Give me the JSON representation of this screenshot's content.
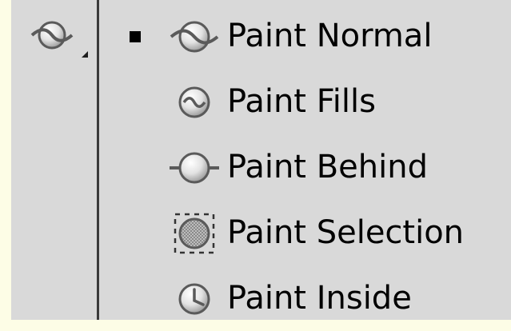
{
  "tool": {
    "icon": "paint-normal-icon",
    "has_flyout": true
  },
  "menu": {
    "items": [
      {
        "label": "Paint Normal",
        "icon": "paint-normal-icon",
        "selected": true
      },
      {
        "label": "Paint Fills",
        "icon": "paint-fills-icon",
        "selected": false
      },
      {
        "label": "Paint Behind",
        "icon": "paint-behind-icon",
        "selected": false
      },
      {
        "label": "Paint Selection",
        "icon": "paint-selection-icon",
        "selected": false
      },
      {
        "label": "Paint Inside",
        "icon": "paint-inside-icon",
        "selected": false
      }
    ]
  },
  "colors": {
    "page_background": "#fdfde6",
    "panel_background": "#d9d9d9",
    "divider": "#3a3a3a",
    "text": "#000000"
  }
}
